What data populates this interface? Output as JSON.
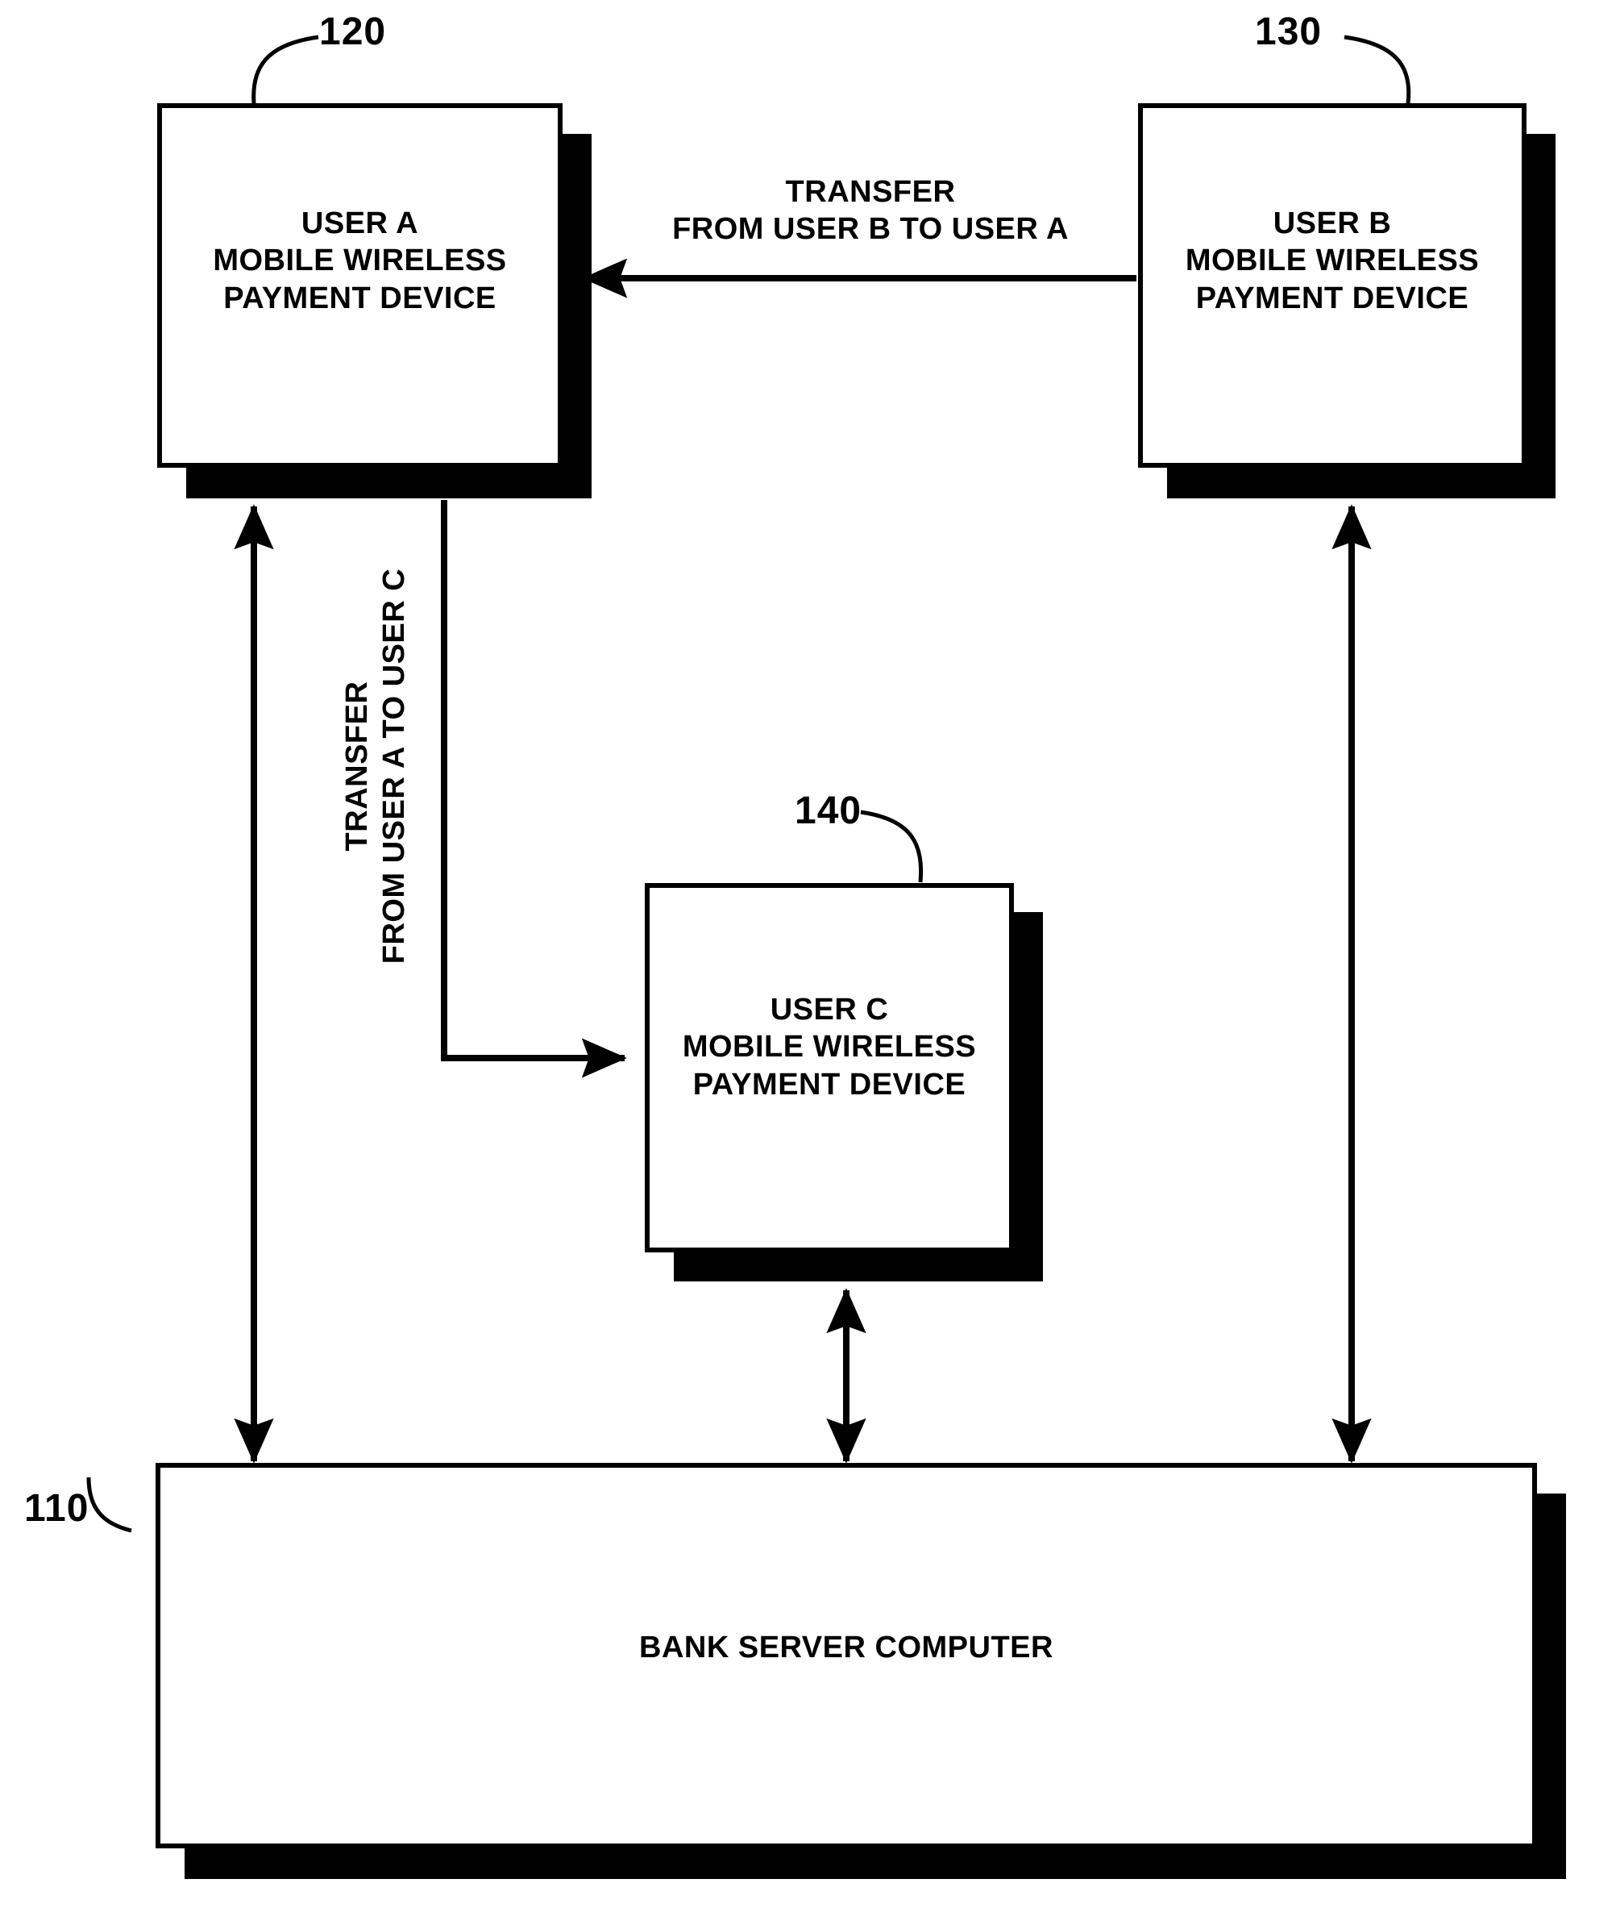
{
  "figure": {
    "type": "patent-block-diagram",
    "background_color": "#ffffff",
    "line_color": "#000000"
  },
  "nodes": [
    {
      "ref": "120",
      "name": "user-a-device",
      "label": "USER A\nMOBILE WIRELESS\nPAYMENT DEVICE"
    },
    {
      "ref": "130",
      "name": "user-b-device",
      "label": "USER B\nMOBILE WIRELESS\nPAYMENT DEVICE"
    },
    {
      "ref": "140",
      "name": "user-c-device",
      "label": "USER C\nMOBILE WIRELESS\nPAYMENT DEVICE"
    },
    {
      "ref": "110",
      "name": "bank-server-computer",
      "label": "BANK SERVER COMPUTER"
    }
  ],
  "connectors": {
    "transfer_b_to_a": {
      "label": "TRANSFER\nFROM USER B TO USER A",
      "direction": "user-b-to-user-a",
      "arrow": "single"
    },
    "transfer_a_to_c": {
      "label": "TRANSFER\nFROM USER A TO USER C",
      "direction": "user-a-to-user-c",
      "arrow": "single"
    },
    "user_a_to_bank": {
      "label": "",
      "direction": "bidirectional",
      "arrow": "double"
    },
    "user_b_to_bank": {
      "label": "",
      "direction": "bidirectional",
      "arrow": "double"
    },
    "user_c_to_bank": {
      "label": "",
      "direction": "bidirectional",
      "arrow": "double"
    }
  },
  "ref_numerals": {
    "n120": "120",
    "n130": "130",
    "n140": "140",
    "n110": "110"
  }
}
